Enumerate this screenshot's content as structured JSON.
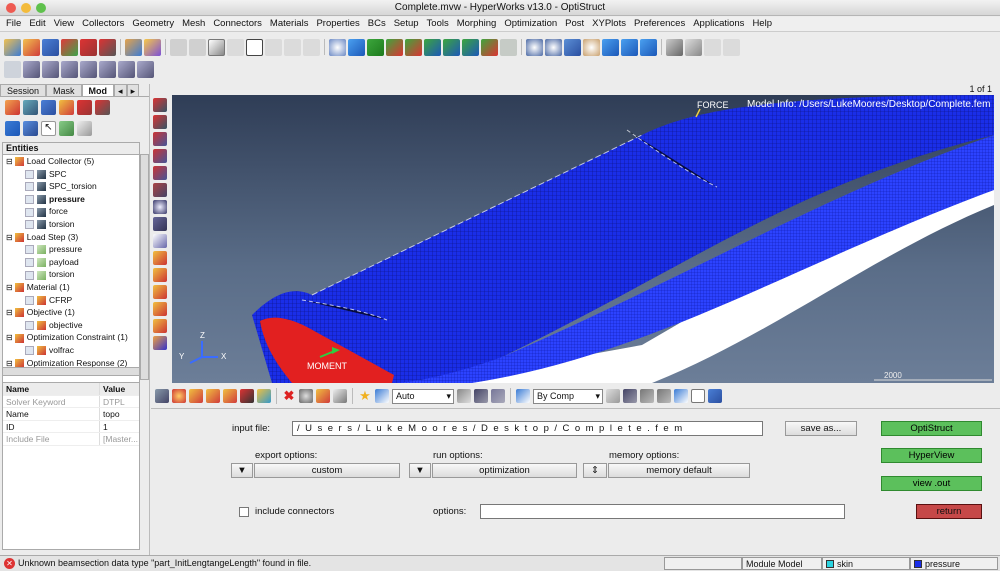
{
  "window": {
    "title": "Complete.mvw - HyperWorks v13.0 - OptiStruct"
  },
  "menu": [
    "File",
    "Edit",
    "View",
    "Collectors",
    "Geometry",
    "Mesh",
    "Connectors",
    "Materials",
    "Properties",
    "BCs",
    "Setup",
    "Tools",
    "Morphing",
    "Optimization",
    "Post",
    "XYPlots",
    "Preferences",
    "Applications",
    "Help"
  ],
  "page_indicator": "1 of 1",
  "left_tabs": [
    "Session",
    "Mask",
    "Mod"
  ],
  "entities_header": "Entities",
  "tree": [
    {
      "label": "Load Collector (5)",
      "level": 0,
      "icon": "load-collector-icon"
    },
    {
      "label": "SPC",
      "level": 1,
      "icon": "load-icon"
    },
    {
      "label": "SPC_torsion",
      "level": 1,
      "icon": "load-icon"
    },
    {
      "label": "pressure",
      "level": 1,
      "icon": "load-icon",
      "bold": true
    },
    {
      "label": "force",
      "level": 1,
      "icon": "load-icon"
    },
    {
      "label": "torsion",
      "level": 1,
      "icon": "load-icon"
    },
    {
      "label": "Load Step (3)",
      "level": 0,
      "icon": "load-step-icon"
    },
    {
      "label": "pressure",
      "level": 1,
      "icon": "step-icon"
    },
    {
      "label": "payload",
      "level": 1,
      "icon": "step-icon"
    },
    {
      "label": "torsion",
      "level": 1,
      "icon": "step-icon"
    },
    {
      "label": "Material (1)",
      "level": 0,
      "icon": "material-icon"
    },
    {
      "label": "CFRP",
      "level": 1,
      "icon": "material-icon"
    },
    {
      "label": "Objective (1)",
      "level": 0,
      "icon": "objective-icon"
    },
    {
      "label": "objective",
      "level": 1,
      "icon": "objective-icon"
    },
    {
      "label": "Optimization Constraint (1)",
      "level": 0,
      "icon": "constraint-icon"
    },
    {
      "label": "volfrac",
      "level": 1,
      "icon": "constraint-icon"
    },
    {
      "label": "Optimization Response (2)",
      "level": 0,
      "icon": "response-icon"
    }
  ],
  "props": {
    "header": {
      "name": "Name",
      "value": "Value"
    },
    "rows": [
      {
        "name": "Solver Keyword",
        "value": "DTPL",
        "muted": true
      },
      {
        "name": "Name",
        "value": "topo"
      },
      {
        "name": "ID",
        "value": "1"
      },
      {
        "name": "Include File",
        "value": "[Master...",
        "muted": true
      }
    ]
  },
  "viewport": {
    "force_label": "FORCE",
    "model_info": "Model Info: /Users/LukeMoores/Desktop/Complete.fem",
    "moment_label": "MOMENT",
    "axis_x": "X",
    "axis_y": "Y",
    "axis_z": "Z",
    "scale_value": "2000"
  },
  "bottom_toolbar": {
    "auto_select": "Auto",
    "comp_select": "By Comp"
  },
  "panel": {
    "input_file_label": "input file:",
    "input_file_value": "/Users/LukeMoores/Desktop/Complete.fem",
    "save_as": "save as...",
    "export_options_label": "export options:",
    "export_options_value": "custom",
    "run_options_label": "run options:",
    "run_options_value": "optimization",
    "memory_options_label": "memory options:",
    "memory_options_value": "memory default",
    "include_connectors": "include connectors",
    "options_label": "options:",
    "options_value": "",
    "optistruct": "OptiStruct",
    "hyperview": "HyperView",
    "view_out": "view .out",
    "return": "return"
  },
  "status": {
    "message": "Unknown beamsection data type \"part_InitLengtangeLength\" found in file.",
    "module": "Module Model",
    "comp1": "skin",
    "comp2": "pressure"
  },
  "colors": {
    "accent_green": "#5cc05c",
    "return_red": "#c64848",
    "mesh_blue": "#1f2fe0",
    "viewport_bg": "#2f3d56"
  }
}
